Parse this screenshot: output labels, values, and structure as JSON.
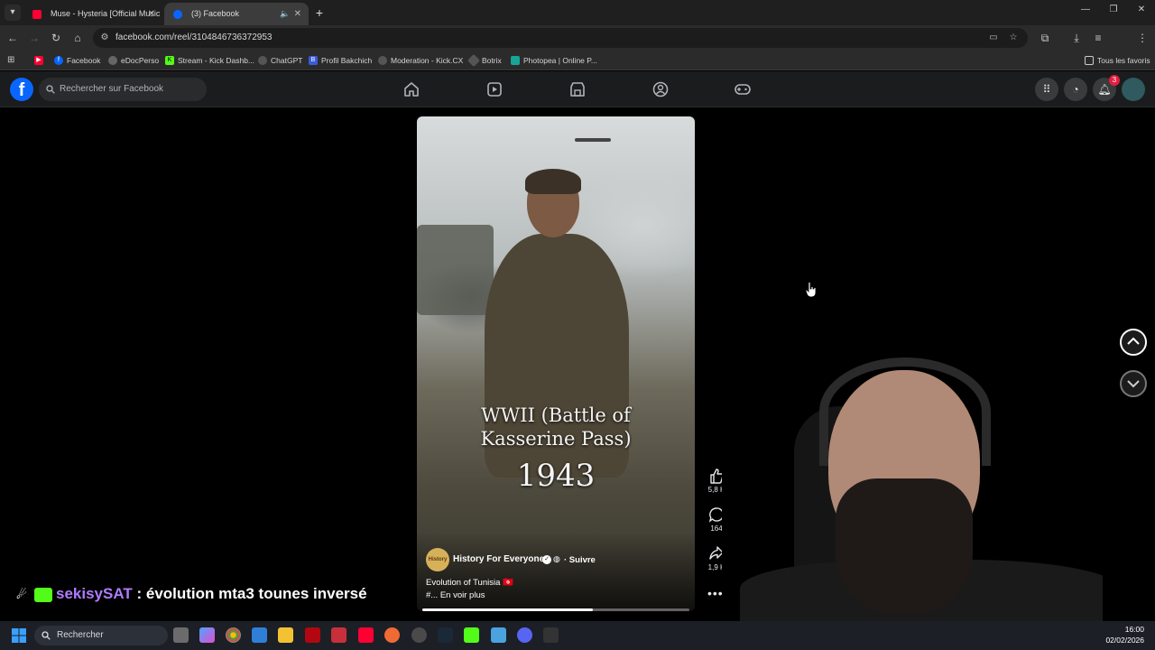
{
  "browser": {
    "tabs": [
      {
        "label": "Muse - Hysteria [Official Music",
        "favicon_color": "#ff0033",
        "active": false
      },
      {
        "label": "(3) Facebook",
        "favicon_color": "#0866ff",
        "active": true
      }
    ],
    "url": "facebook.com/reel/3104846736372953",
    "bookmarks": [
      {
        "label": "",
        "icon": "youtube-icon",
        "color": "#ff0033"
      },
      {
        "label": "Facebook",
        "icon": "facebook-icon",
        "color": "#0866ff"
      },
      {
        "label": "eDocPerso",
        "icon": "edocperso-icon",
        "color": "#888888"
      },
      {
        "label": "Stream - Kick Dashb...",
        "icon": "kick-icon",
        "color": "#53fc18"
      },
      {
        "label": "ChatGPT",
        "icon": "chatgpt-icon",
        "color": "#888888"
      },
      {
        "label": "Profil Bakchich",
        "icon": "bakchich-icon",
        "color": "#3b5bdb"
      },
      {
        "label": "Moderation - Kick.CX",
        "icon": "kickcx-icon",
        "color": "#888888"
      },
      {
        "label": "Botrix",
        "icon": "botrix-icon",
        "color": "#888888"
      },
      {
        "label": "Photopea | Online P...",
        "icon": "photopea-icon",
        "color": "#18a497"
      }
    ],
    "all_bookmarks": "Tous les favoris"
  },
  "facebook": {
    "search_placeholder": "Rechercher sur Facebook",
    "notification_count": "3",
    "brand_color": "#0866ff"
  },
  "reel": {
    "title": "WWII (Battle of Kasserine Pass)",
    "title_line1": "WWII (Battle of",
    "title_line2": "Kasserine Pass)",
    "year": "1943",
    "page_name": "History For Everyone",
    "avatar_text": "History",
    "follow_label": "· Suivre",
    "caption": "Evolution of Tunisia 🇹🇳",
    "caption_more": "#... En voir plus",
    "progress": 0.64,
    "likes": "5,8 K",
    "comments": "164",
    "shares": "1,9 K"
  },
  "chat": {
    "username": "sekisySAT",
    "separator": ":",
    "message": "évolution mta3 tounes inversé"
  },
  "taskbar": {
    "search_label": "Rechercher",
    "time": "16:00",
    "date": "02/02/2026"
  }
}
